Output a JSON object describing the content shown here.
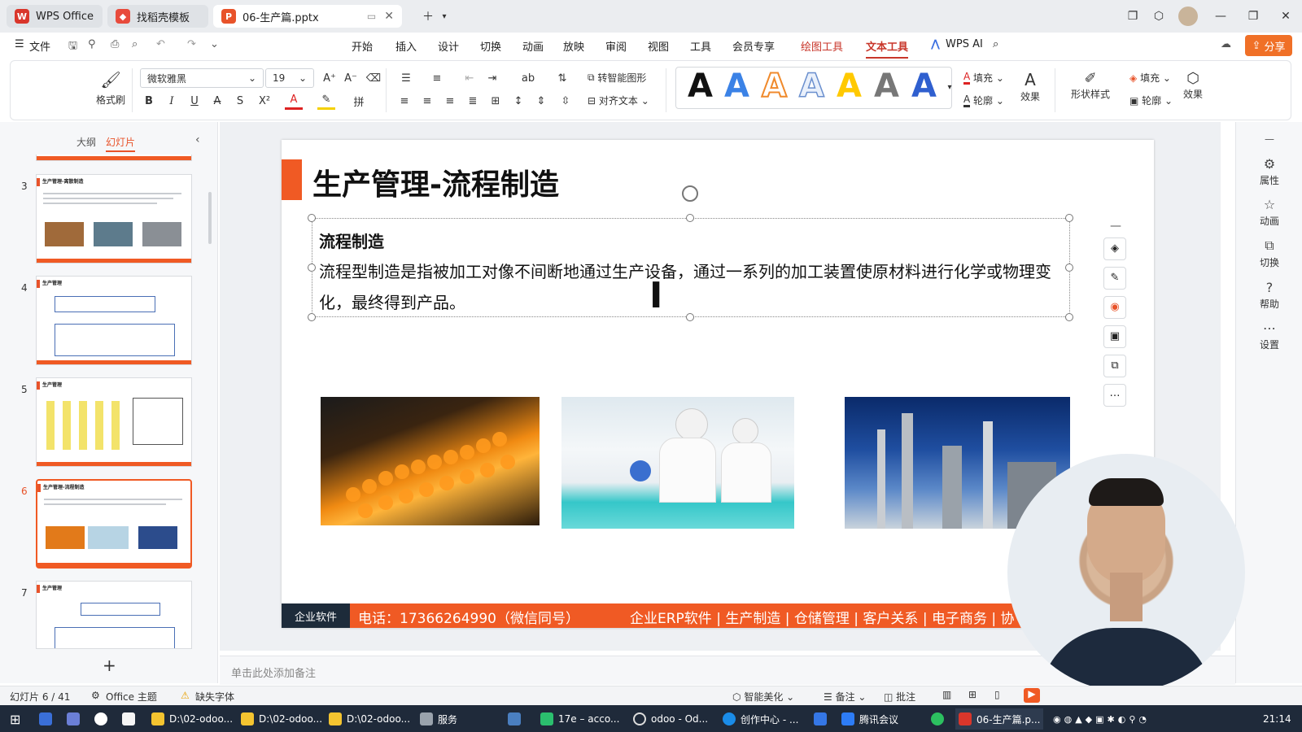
{
  "tabs": [
    {
      "label": "WPS Office",
      "color": "#d9362b"
    },
    {
      "label": "找稻壳模板",
      "color": "#e84b3c"
    },
    {
      "label": "06-生产篇.pptx",
      "color": "#e8532a"
    }
  ],
  "menu": {
    "file": "文件",
    "items": [
      "开始",
      "插入",
      "设计",
      "切换",
      "动画",
      "放映",
      "审阅",
      "视图",
      "工具",
      "会员专享",
      "绘图工具",
      "文本工具"
    ],
    "active": "文本工具",
    "wps_ai": "WPS AI",
    "share": "分享"
  },
  "ribbon": {
    "format_painter": "格式刷",
    "font_name": "微软雅黑",
    "font_size": "19",
    "smart_shape": "转智能图形",
    "align_text": "对齐文本",
    "fill": "填充",
    "outline": "轮廓",
    "effect": "效果",
    "shape_style": "形状样式",
    "fill2": "填充",
    "outline2": "轮廓",
    "effect2": "效果",
    "text_style_letter": "A"
  },
  "panel": {
    "outline_tab": "大纲",
    "slides_tab": "幻灯片",
    "add": "+",
    "slides": [
      {
        "num": "3",
        "title": "生产管理-离散制造"
      },
      {
        "num": "4",
        "title": "生产管理"
      },
      {
        "num": "5",
        "title": "生产管理"
      },
      {
        "num": "6",
        "title": "生产管理-流程制造"
      },
      {
        "num": "7",
        "title": "生产管理"
      }
    ]
  },
  "slide": {
    "title": "生产管理-流程制造",
    "subheading": "流程制造",
    "body": "流程型制造是指被加工对像不间断地通过生产设备，通过一系列的加工装置使原材料进行化学或物理变化，最终得到产品。",
    "footer_left": "企业软件",
    "footer_phone": "电话：17366264990（微信同号）",
    "footer_tags": "企业ERP软件 | 生产制造 | 仓储管理 | 客户关系 | 电子商务 | 协",
    "accent": "#f05a24"
  },
  "notes_placeholder": "单击此处添加备注",
  "rightbar": [
    "属性",
    "动画",
    "切换",
    "帮助",
    "设置"
  ],
  "status": {
    "slide_count": "幻灯片 6 / 41",
    "theme": "Office 主题",
    "missing_font": "缺失字体",
    "smart_beautify": "智能美化",
    "notes": "备注",
    "comments": "批注"
  },
  "taskbar": {
    "items": [
      "D:\\02-odoo...",
      "D:\\02-odoo...",
      "D:\\02-odoo...",
      "服务",
      "17e – acco...",
      "odoo - Od...",
      "创作中心 - ...",
      "腾讯会议",
      "06-生产篇.p..."
    ],
    "time": "21:14"
  }
}
